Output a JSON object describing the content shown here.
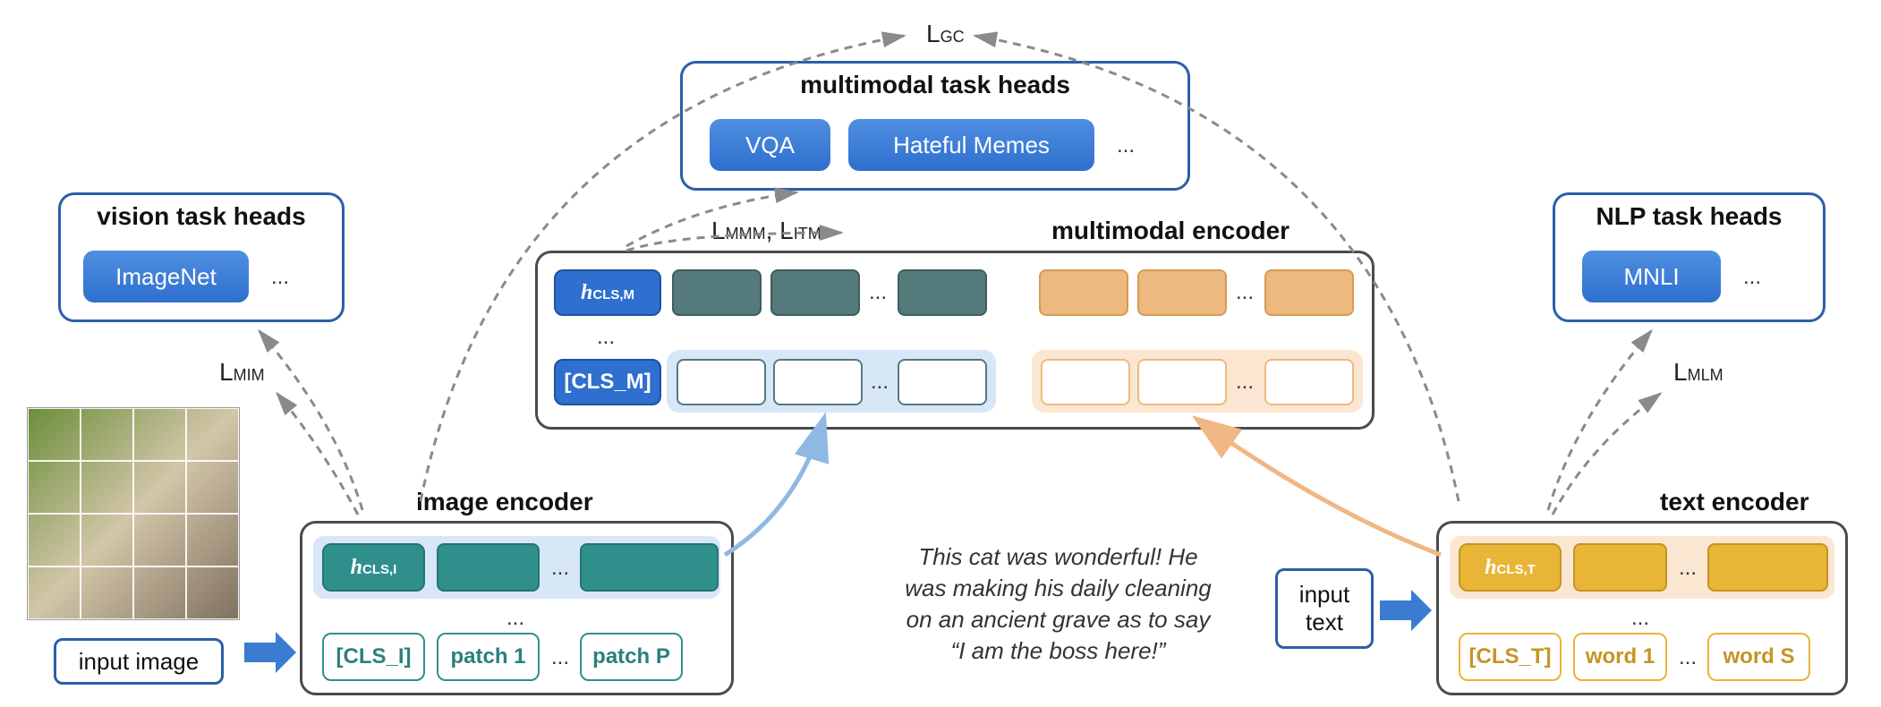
{
  "input_image_label": "input image",
  "input_text_label": "input\ntext",
  "caption_text": "This cat was wonderful! He\nwas making his daily cleaning\non an ancient grave as to say\n“I am the boss here!”",
  "vision_heads": {
    "title": "vision task heads",
    "items": [
      "ImageNet"
    ],
    "more": "..."
  },
  "nlp_heads": {
    "title": "NLP task heads",
    "items": [
      "MNLI"
    ],
    "more": "..."
  },
  "mm_heads": {
    "title": "multimodal task heads",
    "items": [
      "VQA",
      "Hateful Memes"
    ],
    "more": "..."
  },
  "image_encoder": {
    "title": "image encoder",
    "cls_out": "h",
    "cls_out_sub": "CLS,I",
    "cls_in": "[CLS_I]",
    "patch1": "patch 1",
    "patchP": "patch P",
    "dots": "..."
  },
  "text_encoder": {
    "title": "text encoder",
    "cls_out": "h",
    "cls_out_sub": "CLS,T",
    "cls_in": "[CLS_T]",
    "word1": "word 1",
    "wordS": "word S",
    "dots": "..."
  },
  "mm_encoder": {
    "title": "multimodal encoder",
    "cls_out": "h",
    "cls_out_sub": "CLS,M",
    "cls_in": "[CLS_M]",
    "dots": "..."
  },
  "loss": {
    "gc": "L",
    "gc_sub": "GC",
    "mim": "L",
    "mim_sub": "MIM",
    "mlm": "L",
    "mlm_sub": "MLM",
    "mmm_itm": "L",
    "mmm_sub": "MMM",
    "itm": "L",
    "itm_sub": "ITM"
  },
  "colors": {
    "teal": "#2f8f8b",
    "teal_dark": "#2a807d",
    "amber": "#e8b537",
    "amber_dark": "#d0a22b",
    "blue_fill": "#2e6fcf",
    "slate": "#557a7b",
    "peach": "#eeb97e",
    "hl_blue": "#d8e7f7",
    "hl_peach": "#fbe7d1"
  }
}
